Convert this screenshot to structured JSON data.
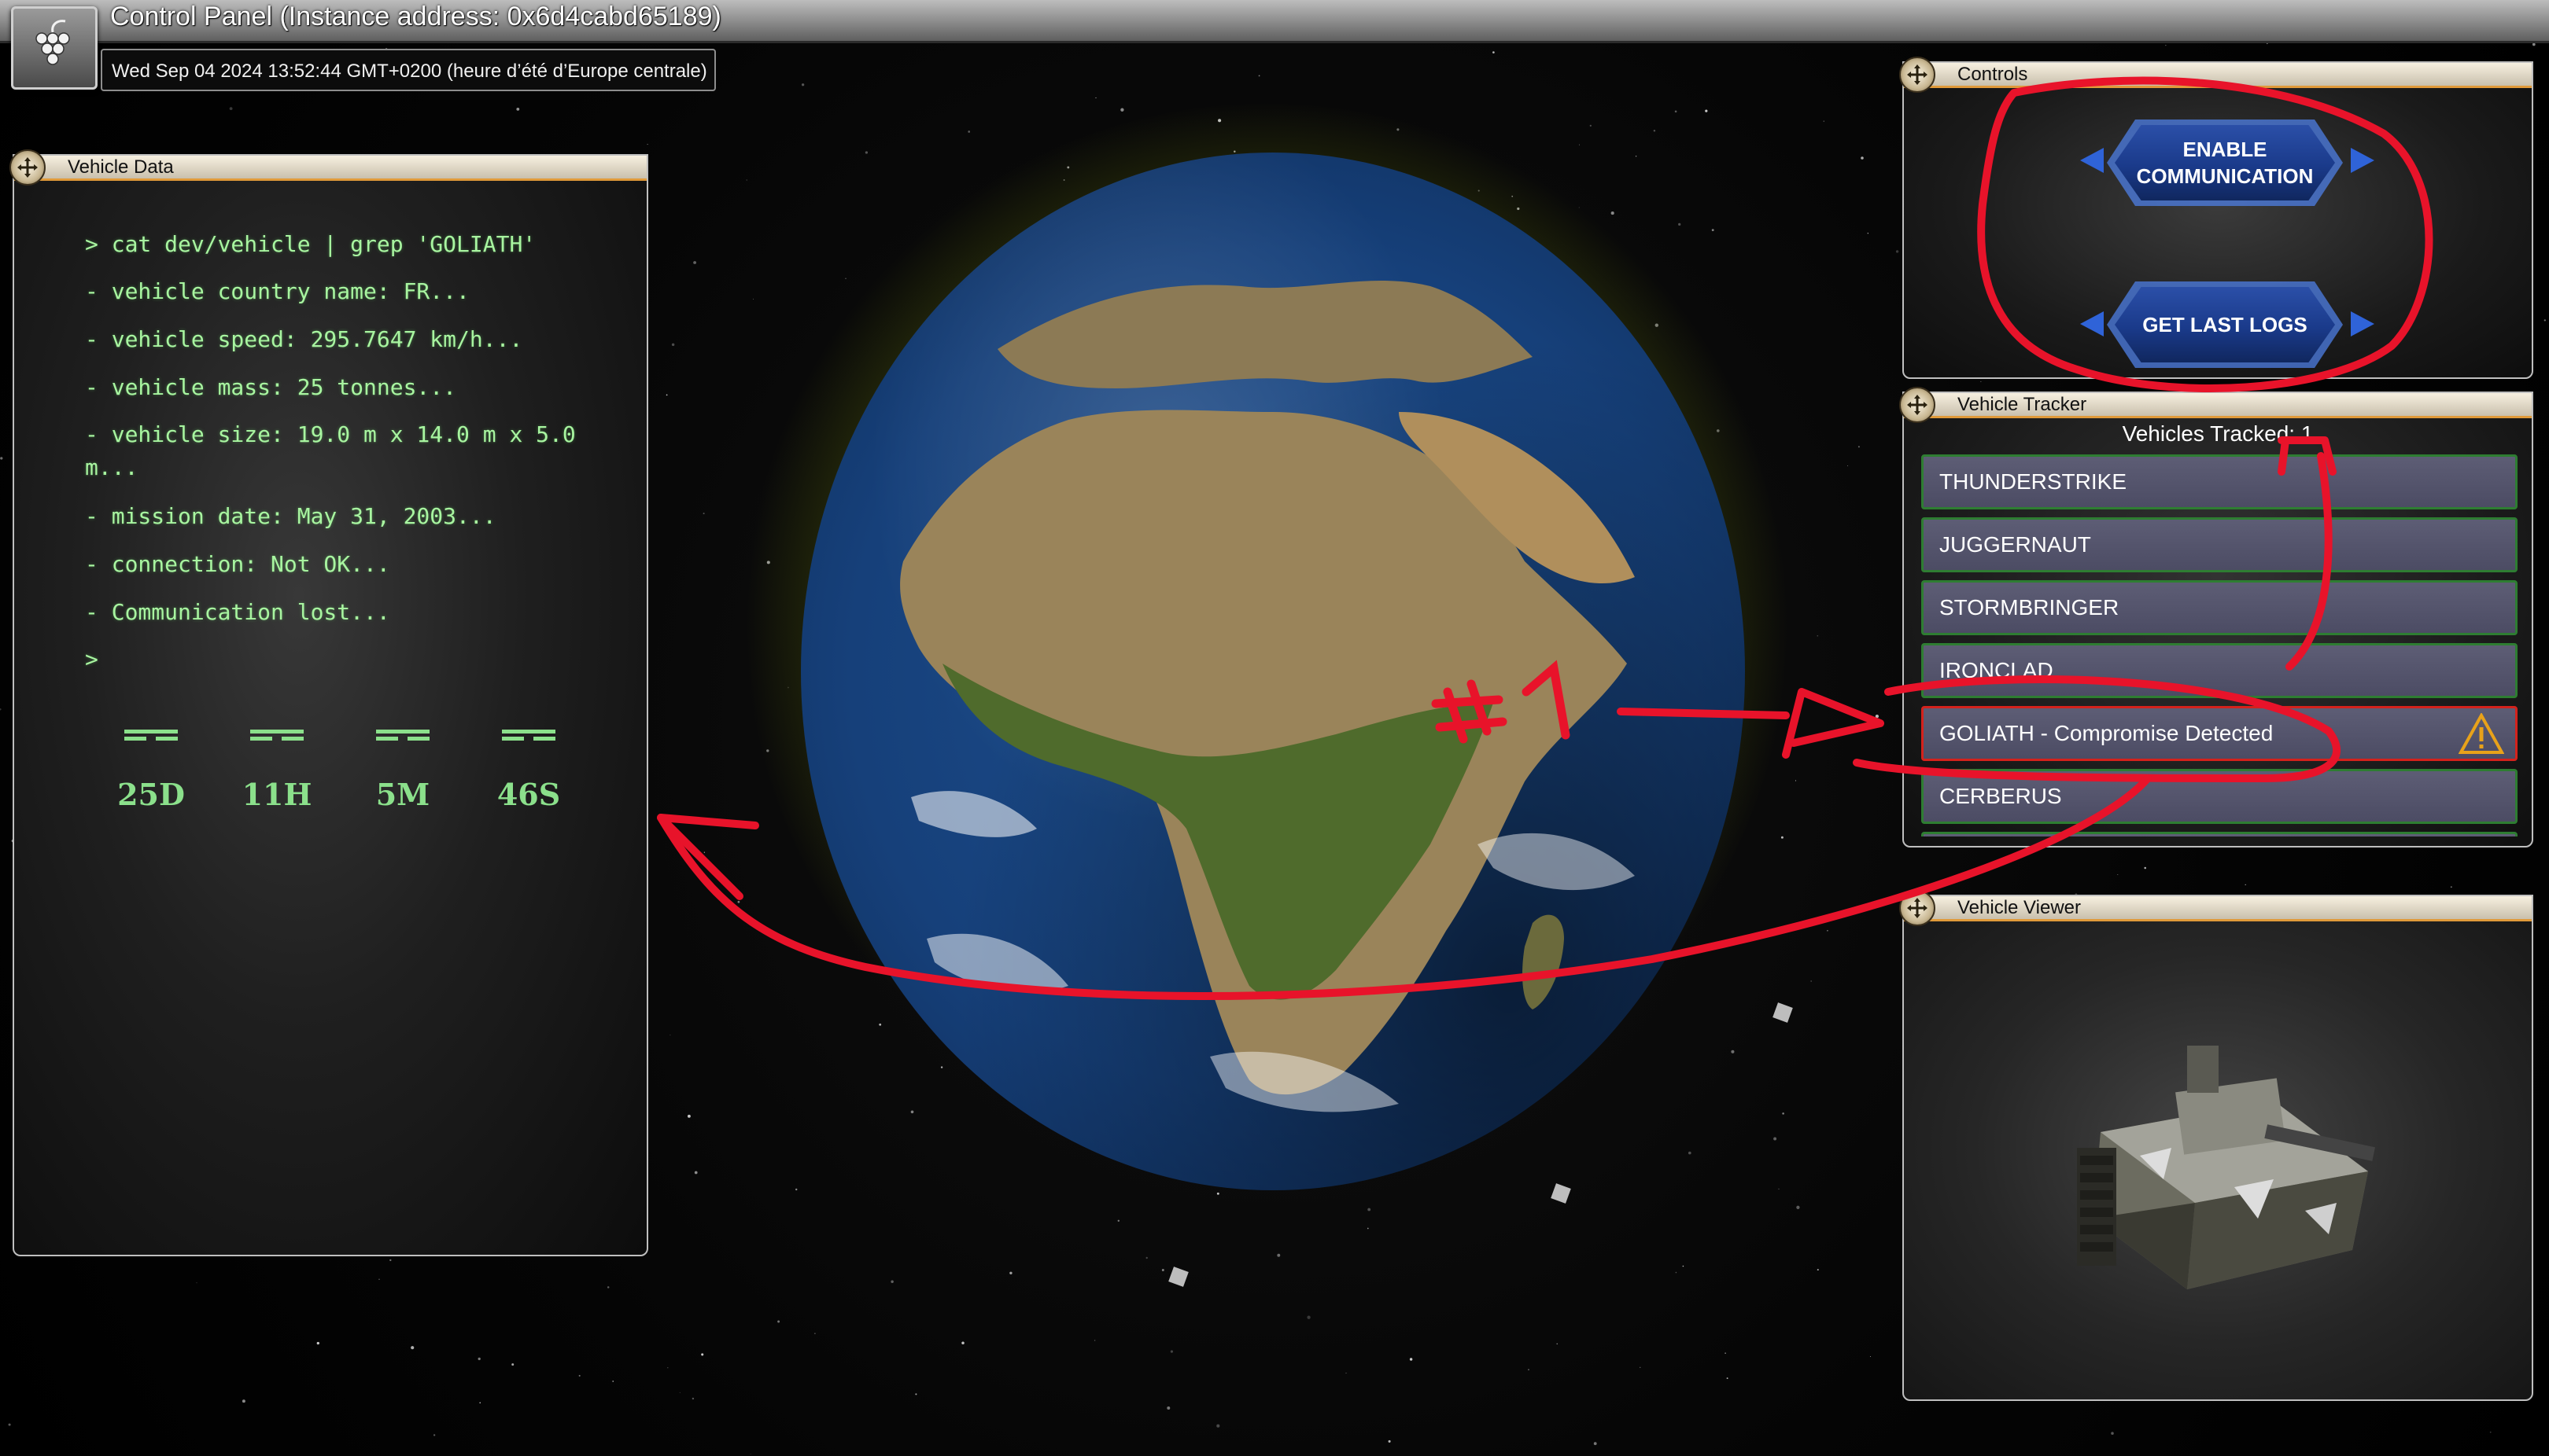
{
  "window": {
    "title": "Control Panel (Instance address: 0x6d4cabd65189)",
    "clock": "Wed Sep 04 2024 13:52:44 GMT+0200 (heure d’été d’Europe centrale)"
  },
  "vehicle_data": {
    "title": "Vehicle Data",
    "lines": [
      "> cat dev/vehicle | grep 'GOLIATH'",
      "- vehicle country name: FR...",
      "- vehicle speed: 295.7647 km/h...",
      "- vehicle mass: 25 tonnes...",
      "- vehicle size: 19.0 m x 14.0 m x 5.0 m...",
      "- mission date: May 31, 2003...",
      "- connection: Not OK...",
      "- Communication lost...",
      ">"
    ],
    "countdown": [
      "25D",
      "11H",
      "5M",
      "46S"
    ]
  },
  "controls": {
    "title": "Controls",
    "buttons": [
      "ENABLE COMMUNICATION",
      "GET LAST LOGS"
    ]
  },
  "tracker": {
    "title": "Vehicle Tracker",
    "count_label": "Vehicles Tracked: 1",
    "vehicles": [
      "THUNDERSTRIKE",
      "JUGGERNAUT",
      "STORMBRINGER",
      "IRONCLAD",
      "GOLIATH - Compromise Detected",
      "CERBERUS"
    ],
    "compromised_index": 4
  },
  "viewer": {
    "title": "Vehicle Viewer"
  },
  "annotation": {
    "text": "#1"
  },
  "colors": {
    "terminal_green": "#a8f5a0",
    "alert_red": "#d4221c",
    "button_blue": "#1a3a8a",
    "panel_accent": "#e09a3a",
    "annotation_red": "#e8132a"
  }
}
